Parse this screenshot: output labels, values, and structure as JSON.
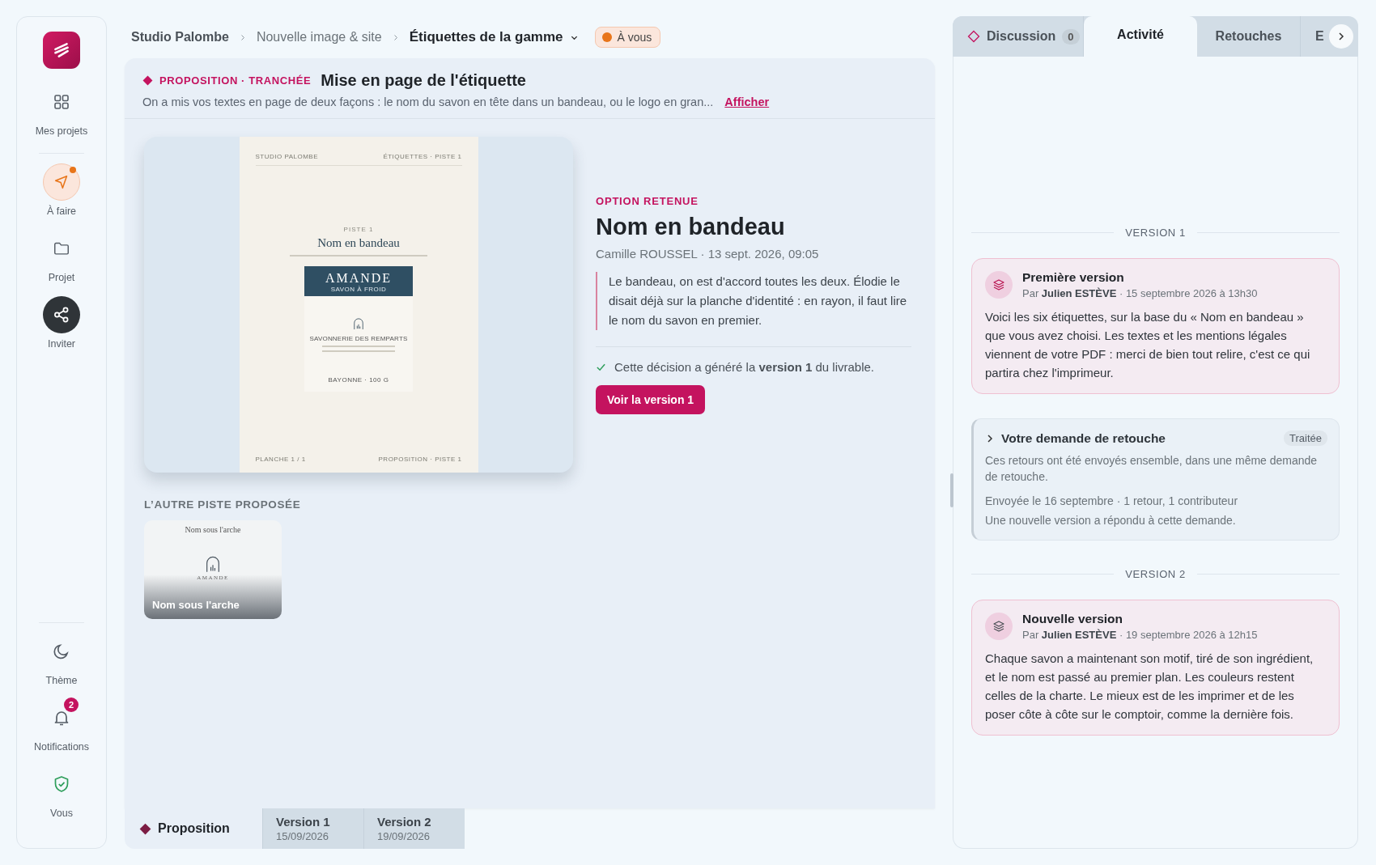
{
  "sidebar": {
    "items": [
      {
        "label": "Mes projets",
        "kind": "nav",
        "selected": false,
        "alert": false
      },
      {
        "label": "À faire",
        "kind": "nav",
        "selected": true,
        "alert": true
      },
      {
        "label": "Projet",
        "kind": "nav",
        "selected": false,
        "alert": false
      },
      {
        "label": "Inviter",
        "kind": "action",
        "selected": false,
        "alert": false
      }
    ],
    "bottom_items": [
      {
        "label": "Thème"
      },
      {
        "label": "Notifications",
        "badge": "2"
      },
      {
        "label": "Vous"
      }
    ]
  },
  "breadcrumb": [
    "Studio Palombe",
    "Nouvelle image & site",
    "Étiquettes de la gamme"
  ],
  "status": {
    "label": "À vous",
    "color": "#e8751a"
  },
  "proposal": {
    "tag": "PROPOSITION · TRANCHÉE",
    "title": "Mise en page de l'étiquette",
    "summary": "On a mis vos textes en page de deux façons : le nom du savon en tête dans un bandeau, ou le logo en gran...",
    "link": "Afficher"
  },
  "preview": {
    "header_left": "STUDIO PALOMBE",
    "header_right": "ÉTIQUETTES · PISTE 1",
    "kicker": "PISTE 1",
    "title": "Nom en bandeau",
    "band_title": "AMANDE",
    "band_subtitle": "SAVON À FROID",
    "maker": "SAVONNERIE DES REMPARTS",
    "footer_label": "BAYONNE · 100 G",
    "page_left": "PLANCHE 1 / 1",
    "page_right": "PROPOSITION · PISTE 1"
  },
  "decision": {
    "label": "OPTION RETENUE",
    "title": "Nom en bandeau",
    "meta": "Camille ROUSSEL · 13 sept. 2026, 09:05",
    "quote": "Le bandeau, on est d'accord toutes les deux. Élodie le disait déjà sur la planche d'identité : en rayon, il faut lire le nom du savon en premier.",
    "note": "Cette décision a généré la **version 1** du livrable.",
    "button": "Voir la version 1"
  },
  "other": {
    "heading": "L’AUTRE PISTE PROPOSÉE",
    "items": [
      {
        "caption": "Nom sous l'arche",
        "doc_title": "Nom sous l'arche",
        "doc_brand": "AMANDE"
      }
    ]
  },
  "bottom_tabs": [
    {
      "label": "Proposition",
      "selected": true
    },
    {
      "label": "Version 1",
      "date": "15/09/2026",
      "selected": false
    },
    {
      "label": "Version 2",
      "date": "19/09/2026",
      "selected": false
    }
  ],
  "panel_tabs": [
    {
      "label": "Discussion",
      "count": "0",
      "selected": false
    },
    {
      "label": "Activité",
      "selected": true
    },
    {
      "label": "Retouches",
      "selected": false
    },
    {
      "label": "E",
      "selected": false
    }
  ],
  "feed": [
    {
      "kind": "divider",
      "label": "VERSION 1"
    },
    {
      "kind": "version",
      "title": "Première version",
      "by": "Par",
      "author": "Julien ESTÈVE",
      "date": " · 15 septembre 2026 à 13h30",
      "body": "Voici les six étiquettes, sur la base du « Nom en bandeau » que vous avez choisi. Les textes et les mentions légales viennent de votre PDF : merci de bien tout relire, c'est ce qui partira chez l'imprimeur."
    },
    {
      "kind": "request",
      "title": "Votre demande de retouche",
      "status": "Traitée",
      "expanded": false,
      "body": "Ces retours ont été envoyés ensemble, dans une même demande de retouche.",
      "meta": "Envoyée le 16 septembre · 1 retour, 1 contributeur",
      "footer": "Une nouvelle version a répondu à cette demande."
    },
    {
      "kind": "divider",
      "label": "VERSION 2"
    },
    {
      "kind": "version",
      "title": "Nouvelle version",
      "by": "Par",
      "author": "Julien ESTÈVE",
      "date": " · 19 septembre 2026 à 12h15",
      "body": "Chaque savon a maintenant son motif, tiré de son ingrédient, et le nom est passé au premier plan. Les couleurs restent celles de la charte. Le mieux est de les imprimer et de les poser côte à côte sur le comptoir, comme la dernière fois."
    }
  ]
}
